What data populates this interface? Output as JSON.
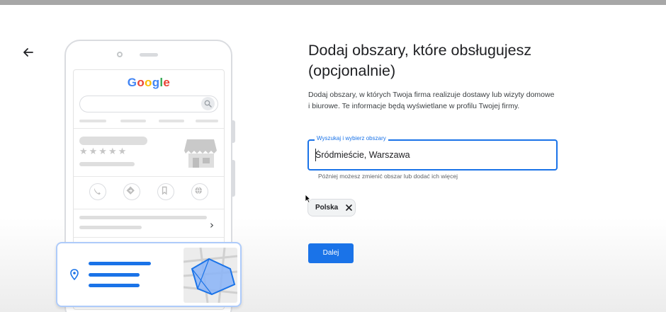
{
  "illustration": {
    "google_logo": [
      "G",
      "o",
      "o",
      "g",
      "l",
      "e"
    ],
    "google_colors": [
      "#4285F4",
      "#EA4335",
      "#FBBC05",
      "#4285F4",
      "#34A853",
      "#EA4335"
    ],
    "stars": "★★★★★",
    "icons": [
      "phone-icon",
      "directions-icon",
      "save-icon",
      "website-icon",
      "chevron-right-icon",
      "location-pin-icon",
      "store-icon",
      "map-icon"
    ]
  },
  "form": {
    "title_line1": "Dodaj obszary, które obsługujesz",
    "title_line2": "(opcjonalnie)",
    "description": "Dodaj obszary, w których Twoja firma realizuje dostawy lub wizyty domowe i biurowe. Te informacje będą wyświetlane w profilu Twojej firmy.",
    "search_label": "Wyszukaj i wybierz obszary",
    "search_value": "Śródmieście, Warszawa",
    "helper_text": "Później możesz zmienić obszar lub dodać ich więcej",
    "chips": [
      {
        "label": "Polska"
      }
    ],
    "next_label": "Dalej"
  },
  "colors": {
    "accent": "#1a73e8",
    "accent_light": "#aecbfa",
    "chip_bg": "#f1f3f4"
  }
}
